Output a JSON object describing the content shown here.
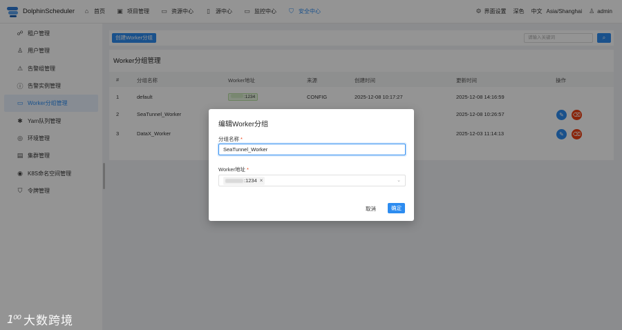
{
  "app": {
    "name": "DolphinScheduler"
  },
  "nav": [
    {
      "label": "首页",
      "icon": "home-icon"
    },
    {
      "label": "项目管理",
      "icon": "project-icon"
    },
    {
      "label": "资源中心",
      "icon": "folder-icon"
    },
    {
      "label": "源中心",
      "icon": "datasource-icon"
    },
    {
      "label": "监控中心",
      "icon": "monitor-icon"
    },
    {
      "label": "安全中心",
      "icon": "shield-icon"
    }
  ],
  "top_right": {
    "ui_settings": "界面设置",
    "theme": "深色",
    "language": "中文",
    "timezone": "Asia/Shanghai",
    "user": "admin"
  },
  "sidebar": [
    {
      "label": "租户管理",
      "icon": "tenant-icon"
    },
    {
      "label": "用户管理",
      "icon": "user-icon"
    },
    {
      "label": "告警组管理",
      "icon": "alert-group-icon"
    },
    {
      "label": "告警实例管理",
      "icon": "alert-instance-icon"
    },
    {
      "label": "Worker分组管理",
      "icon": "worker-group-icon"
    },
    {
      "label": "Yarn队列管理",
      "icon": "yarn-queue-icon"
    },
    {
      "label": "环境管理",
      "icon": "environment-icon"
    },
    {
      "label": "集群管理",
      "icon": "cluster-icon"
    },
    {
      "label": "K8S命名空间管理",
      "icon": "k8s-namespace-icon"
    },
    {
      "label": "令牌管理",
      "icon": "token-icon"
    }
  ],
  "toolbar": {
    "create_label": "创建Worker分组",
    "search_placeholder": "请输入关键词"
  },
  "panel": {
    "title": "Worker分组管理"
  },
  "table": {
    "headers": [
      "#",
      "分组名称",
      "Worker地址",
      "来源",
      "创建时间",
      "更新时间",
      "操作"
    ],
    "rows": [
      {
        "index": "1",
        "name": "default",
        "address": ":1234",
        "source": "CONFIG",
        "created": "2025-12-08 10:17:27",
        "updated": "2025-12-08 14:16:59"
      },
      {
        "index": "2",
        "name": "SeaTunnel_Worker",
        "address": "",
        "source": "",
        "created": "",
        "updated": "2025-12-08 10:26:57"
      },
      {
        "index": "3",
        "name": "DataX_Worker",
        "address": "",
        "source": "",
        "created": "",
        "updated": "2025-12-03 11:14:13"
      }
    ]
  },
  "modal": {
    "title": "编辑Worker分组",
    "name_label": "分组名称",
    "name_value": "SeaTunnel_Worker",
    "address_label": "Worker地址",
    "address_tag": ":1234",
    "required_mark": "*",
    "cancel_label": "取消",
    "ok_label": "确定"
  },
  "watermark": {
    "logo": "1⁰⁰",
    "text": "大数跨境"
  }
}
